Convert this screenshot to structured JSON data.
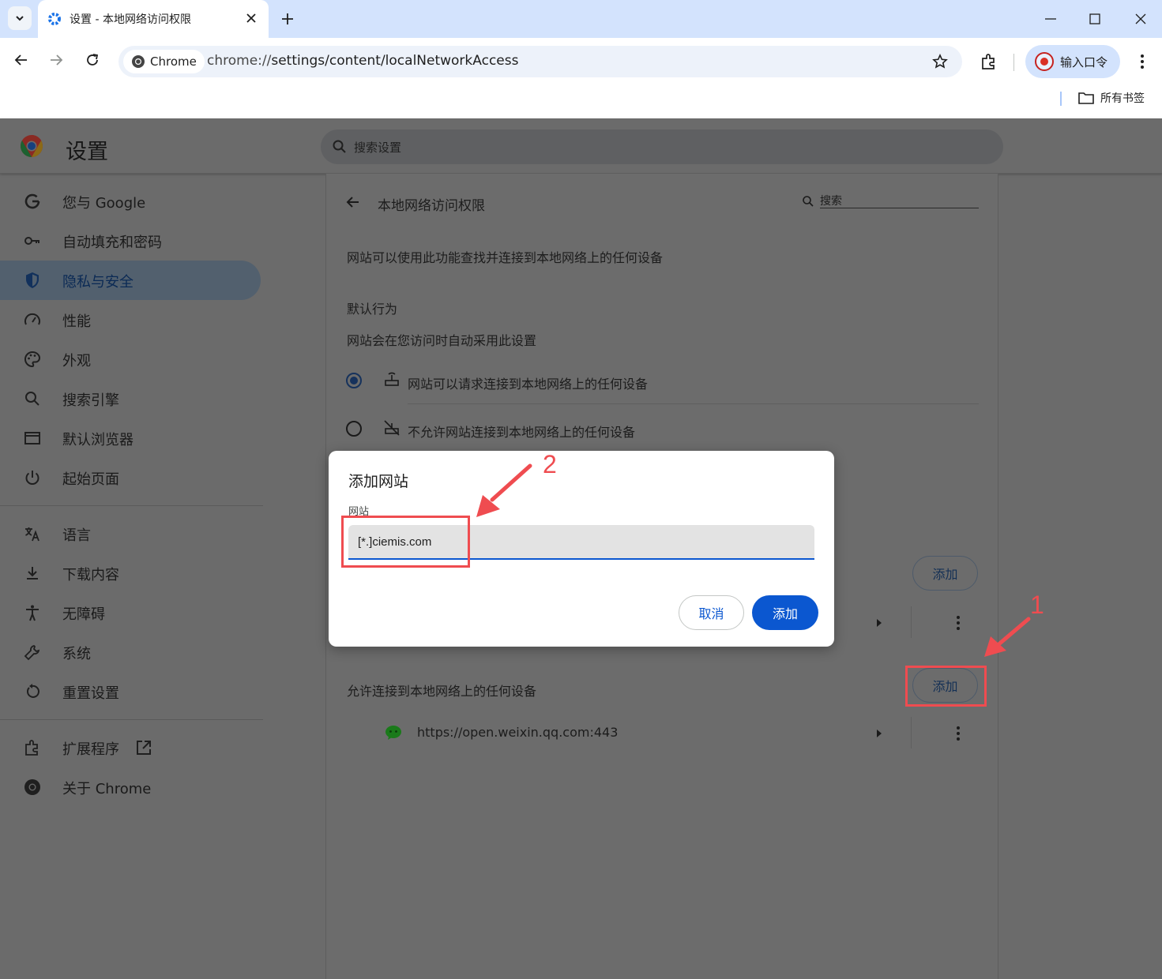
{
  "browser": {
    "tab_title": "设置 - 本地网络访问权限",
    "chip_label": "Chrome",
    "url_prefix": "chrome://",
    "url_path": "settings/content/localNetworkAccess",
    "profile_label": "输入口令",
    "bookmarks_folder": "所有书签"
  },
  "header": {
    "title": "设置",
    "search_placeholder": "搜索设置"
  },
  "sidebar": {
    "items": [
      {
        "label": "您与 Google",
        "icon": "google-g-icon"
      },
      {
        "label": "自动填充和密码",
        "icon": "key-icon"
      },
      {
        "label": "隐私与安全",
        "icon": "shield-icon",
        "active": true
      },
      {
        "label": "性能",
        "icon": "speedometer-icon"
      },
      {
        "label": "外观",
        "icon": "palette-icon"
      },
      {
        "label": "搜索引擎",
        "icon": "search-icon"
      },
      {
        "label": "默认浏览器",
        "icon": "browser-window-icon"
      },
      {
        "label": "起始页面",
        "icon": "power-icon"
      },
      {
        "label": "语言",
        "icon": "translate-icon"
      },
      {
        "label": "下载内容",
        "icon": "download-icon"
      },
      {
        "label": "无障碍",
        "icon": "accessibility-icon"
      },
      {
        "label": "系统",
        "icon": "wrench-icon"
      },
      {
        "label": "重置设置",
        "icon": "reset-icon"
      },
      {
        "label": "扩展程序",
        "icon": "puzzle-icon"
      },
      {
        "label": "关于 Chrome",
        "icon": "chrome-icon"
      }
    ]
  },
  "content": {
    "subpage_title": "本地网络访问权限",
    "search_placeholder": "搜索",
    "description": "网站可以使用此功能查找并连接到本地网络上的任何设备",
    "default_behavior_heading": "默认行为",
    "default_behavior_desc": "网站会在您访问时自动采用此设置",
    "option_allow": "网站可以请求连接到本地网络上的任何设备",
    "option_block": "不允许网站连接到本地网络上的任何设备",
    "add_button_1": "添加",
    "allowed_heading": "允许连接到本地网络上的任何设备",
    "add_button_2": "添加",
    "allowed_site": "https://open.weixin.qq.com:443"
  },
  "dialog": {
    "title": "添加网站",
    "field_label": "网站",
    "field_value": "[*.]ciemis.com",
    "cancel_label": "取消",
    "add_label": "添加"
  },
  "annotations": {
    "step1": "1",
    "step2": "2",
    "color": "#ef4c50"
  },
  "colors": {
    "accent": "#0b57d0",
    "tabstrip": "#d3e3fd"
  }
}
